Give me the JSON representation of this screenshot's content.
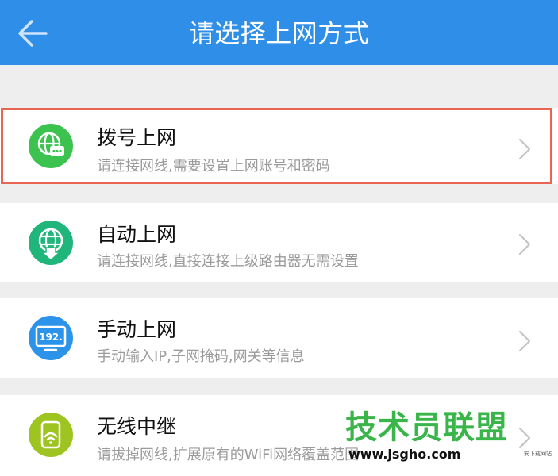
{
  "header": {
    "title": "请选择上网方式",
    "back_icon": "arrow-left-icon",
    "background": "#2f8ee8"
  },
  "items": [
    {
      "title": "拨号上网",
      "desc": "请连接网线,需要设置上网账号和密码",
      "icon": "globe-dial-icon",
      "icon_color": "#3cc24f",
      "selected": true
    },
    {
      "title": "自动上网",
      "desc": "请连接网线,直接连接上级路由器无需设置",
      "icon": "globe-download-icon",
      "icon_color": "#20b57b",
      "selected": false
    },
    {
      "title": "手动上网",
      "desc": "手动输入IP,子网掩码,网关等信息",
      "icon": "monitor-ip-icon",
      "icon_color": "#2c93ea",
      "icon_text": "192.",
      "selected": false
    },
    {
      "title": "无线中继",
      "desc": "请拔掉网线,扩展原有的WiFi网络覆盖范围",
      "icon": "wireless-router-icon",
      "icon_color": "#9dc421",
      "selected": false
    }
  ],
  "highlight_color": "#e96552",
  "watermark": {
    "main": "技术员联盟",
    "url": "www.jsgho.com",
    "small": "安下载网站"
  }
}
